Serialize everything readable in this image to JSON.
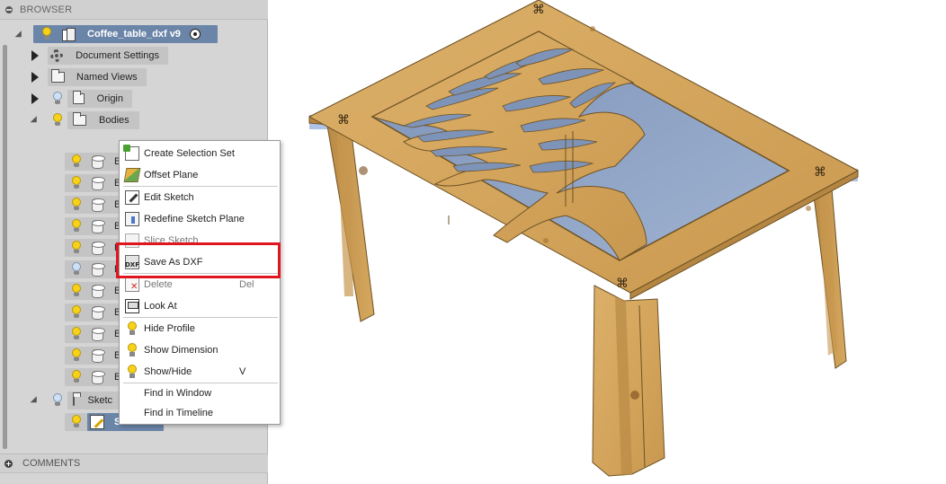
{
  "browser": {
    "header": "BROWSER",
    "root": {
      "label": "Coffee_table_dxf v9"
    },
    "nodes": {
      "document_settings": "Document Settings",
      "named_views": "Named Views",
      "origin": "Origin",
      "bodies": "Bodies",
      "sketches": "Sketc",
      "sketch_item": "S"
    },
    "body_items": [
      "B",
      "B",
      "B",
      "B",
      "B",
      "B",
      "B",
      "B",
      "B",
      "B",
      "B"
    ],
    "comments": "COMMENTS"
  },
  "context_menu": {
    "items": [
      {
        "label": "Create Selection Set",
        "icon": "selection-set-icon"
      },
      {
        "label": "Offset Plane",
        "icon": "offset-plane-icon"
      },
      {
        "label": "Edit Sketch",
        "icon": "edit-sketch-icon"
      },
      {
        "label": "Redefine Sketch Plane",
        "icon": "redefine-plane-icon"
      },
      {
        "label": "Slice Sketch",
        "icon": "slice-sketch-icon"
      },
      {
        "label": "Save As DXF",
        "icon": "dxf-icon",
        "highlighted": true
      },
      {
        "label": "Delete",
        "shortcut": "Del",
        "icon": "delete-icon"
      },
      {
        "label": "Look At",
        "icon": "look-at-icon"
      },
      {
        "label": "Hide Profile",
        "icon": "bulb-icon"
      },
      {
        "label": "Show Dimension",
        "icon": "bulb-icon"
      },
      {
        "label": "Show/Hide",
        "shortcut": "V",
        "icon": "bulb-icon"
      },
      {
        "label": "Find in Window"
      },
      {
        "label": "Find in Timeline"
      }
    ],
    "dxf_icon_text": "DXF"
  },
  "viewport": {
    "model": "coffee table with tree-pattern tabletop",
    "colors": {
      "wood": "#d9ab62",
      "glass": "#8ea3c7",
      "highlight": "#e0151e"
    }
  }
}
